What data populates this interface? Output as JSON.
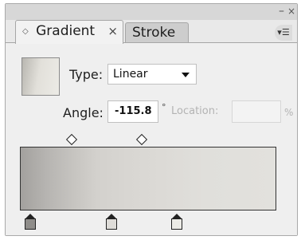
{
  "tabs": [
    {
      "label": "Gradient",
      "close": "×",
      "grip": "◇",
      "active": true
    },
    {
      "label": "Stroke",
      "active": false
    }
  ],
  "window_controls": {
    "minimize": "–",
    "close": "×"
  },
  "panel_menu": "▾☰",
  "type": {
    "label": "Type:",
    "value": "Linear"
  },
  "angle": {
    "label": "Angle:",
    "value": "-115.8",
    "icon": "°"
  },
  "location": {
    "label": "Location:",
    "value": "",
    "unit": "%"
  }
}
